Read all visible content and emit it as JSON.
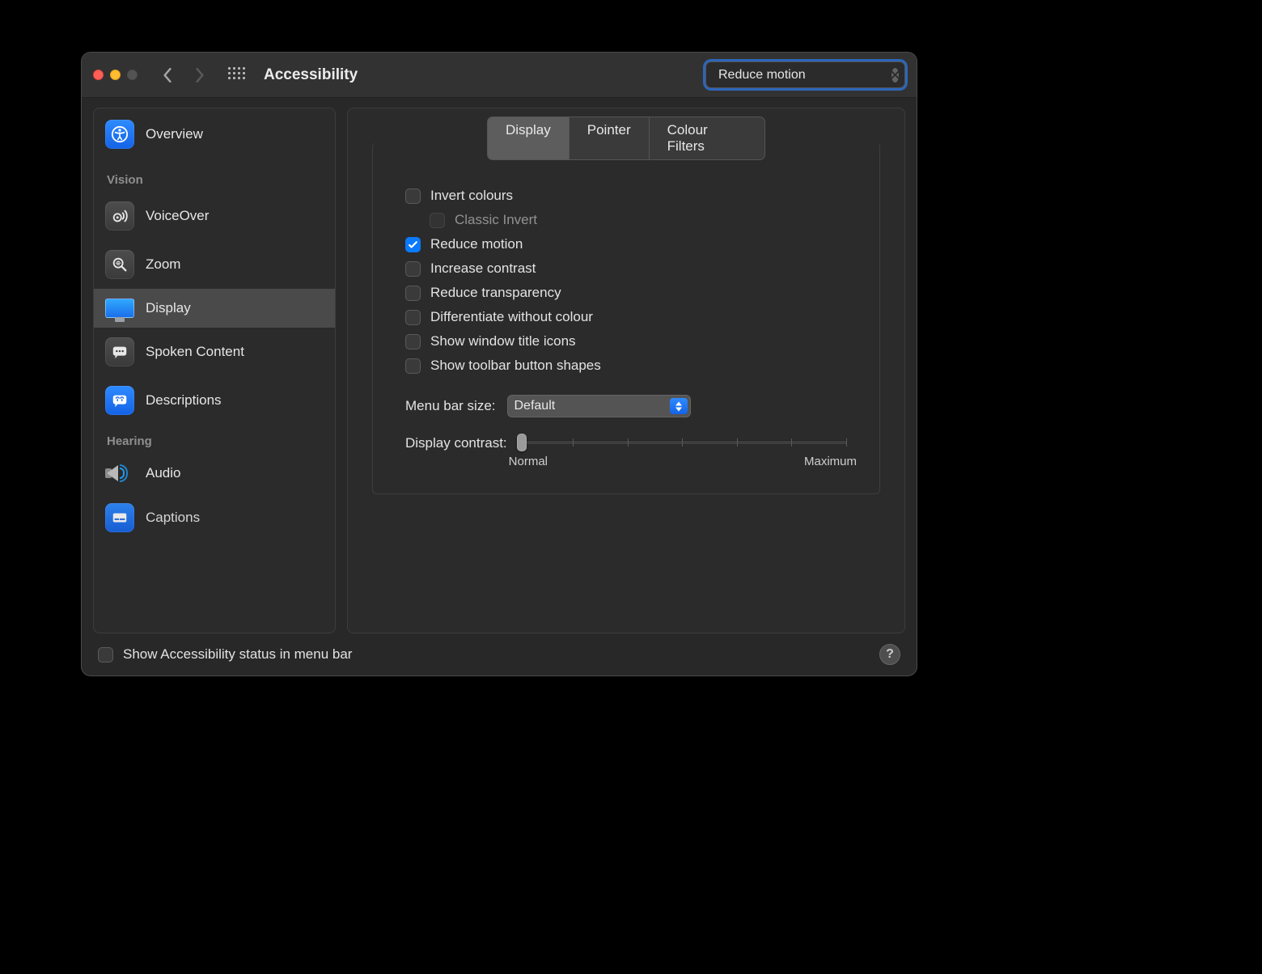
{
  "window": {
    "title": "Accessibility"
  },
  "search": {
    "value": "Reduce motion"
  },
  "sidebar": {
    "overview": "Overview",
    "sections": [
      {
        "title": "Vision",
        "items": [
          {
            "id": "voiceover",
            "label": "VoiceOver"
          },
          {
            "id": "zoom",
            "label": "Zoom"
          },
          {
            "id": "display",
            "label": "Display",
            "selected": true
          },
          {
            "id": "spoken",
            "label": "Spoken Content"
          },
          {
            "id": "descriptions",
            "label": "Descriptions"
          }
        ]
      },
      {
        "title": "Hearing",
        "items": [
          {
            "id": "audio",
            "label": "Audio"
          },
          {
            "id": "captions",
            "label": "Captions"
          }
        ]
      }
    ]
  },
  "tabs": {
    "display": "Display",
    "pointer": "Pointer",
    "colour_filters": "Colour Filters",
    "active": "display"
  },
  "options": {
    "invert_colours": {
      "label": "Invert colours",
      "checked": false
    },
    "classic_invert": {
      "label": "Classic Invert",
      "checked": false
    },
    "reduce_motion": {
      "label": "Reduce motion",
      "checked": true
    },
    "increase_contrast": {
      "label": "Increase contrast",
      "checked": false
    },
    "reduce_transparency": {
      "label": "Reduce transparency",
      "checked": false
    },
    "differentiate_without_colour": {
      "label": "Differentiate without colour",
      "checked": false
    },
    "show_window_title_icons": {
      "label": "Show window title icons",
      "checked": false
    },
    "show_toolbar_button_shapes": {
      "label": "Show toolbar button shapes",
      "checked": false
    }
  },
  "menu_bar_size": {
    "label": "Menu bar size:",
    "value": "Default"
  },
  "display_contrast": {
    "label": "Display contrast:",
    "min_label": "Normal",
    "max_label": "Maximum"
  },
  "footer": {
    "show_status_label": "Show Accessibility status in menu bar",
    "show_status_checked": false
  }
}
